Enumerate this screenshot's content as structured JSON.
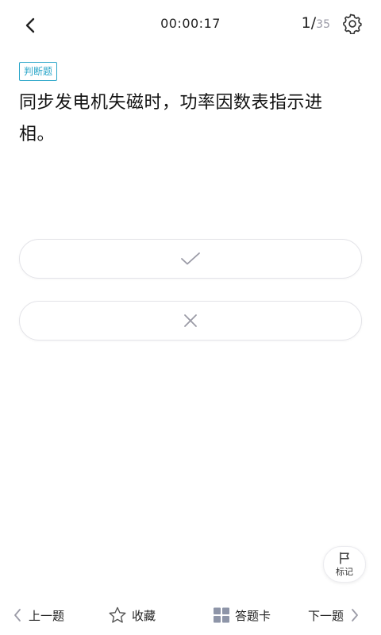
{
  "header": {
    "timer": "00:00:17",
    "current_index": "1/",
    "total": "35"
  },
  "question": {
    "type_label": "判断题",
    "text": "同步发电机失磁时，功率因数表指示进相。"
  },
  "options": [
    {
      "icon": "check-icon"
    },
    {
      "icon": "close-icon"
    }
  ],
  "mark": {
    "label": "标记",
    "icon": "flag-icon"
  },
  "bottom_bar": {
    "prev_label": "上一题",
    "favorite_label": "收藏",
    "answer_card_label": "答题卡",
    "next_label": "下一题"
  },
  "colors": {
    "accent": "#2aa6c9",
    "icon_gray": "#9a9aa6",
    "option_border": "#e3e3e8"
  }
}
